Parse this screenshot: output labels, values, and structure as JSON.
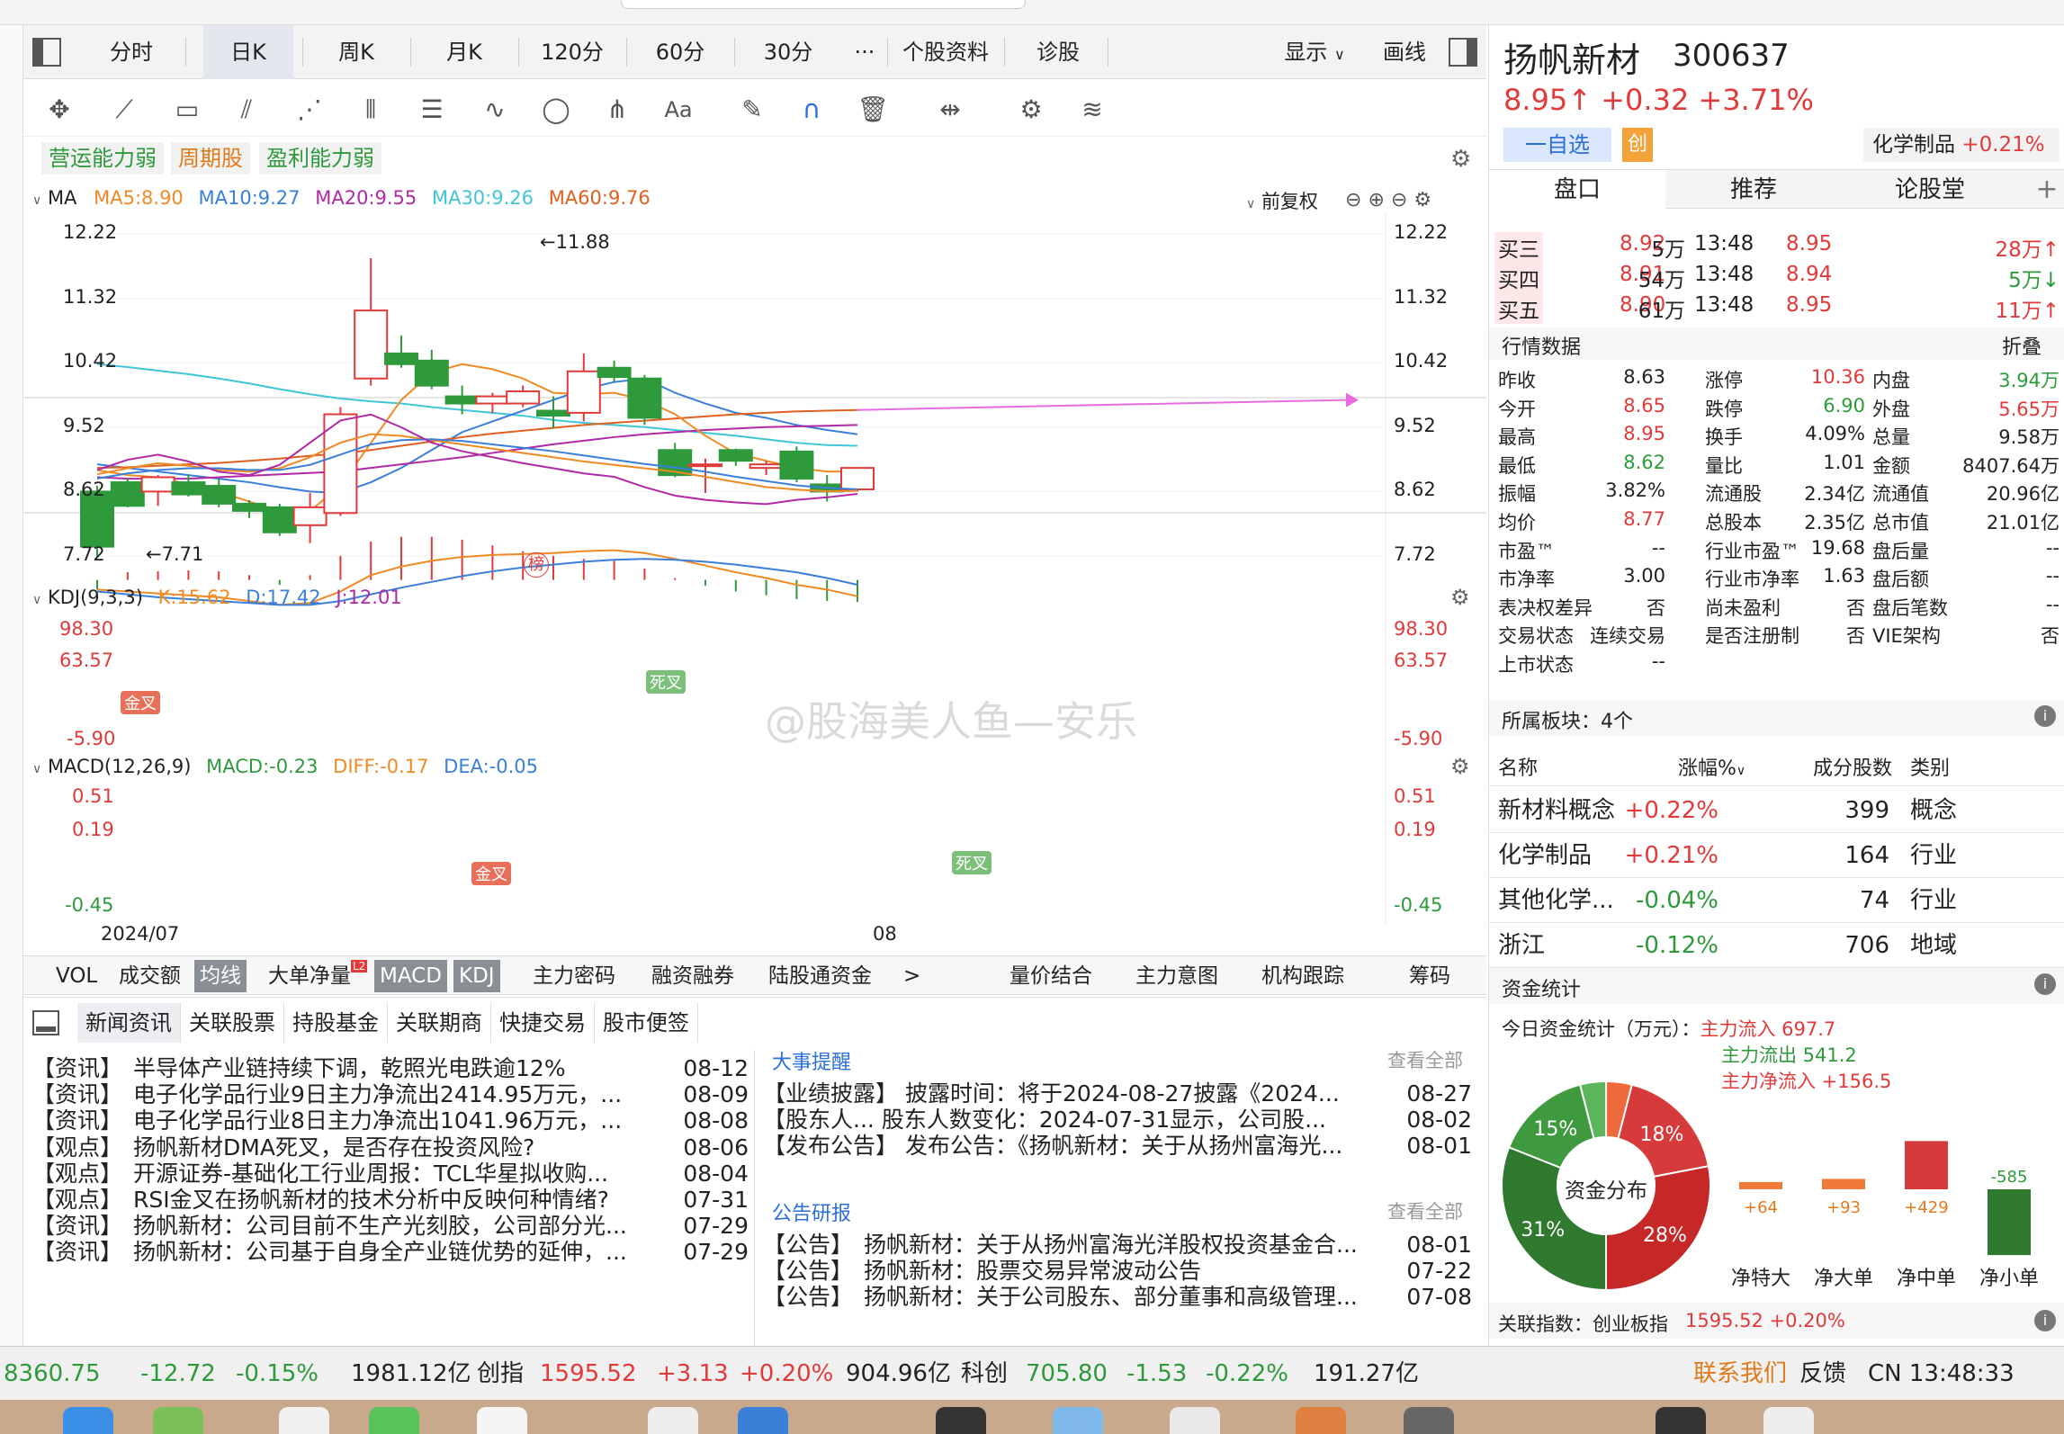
{
  "kline_tabs": [
    "分时",
    "日K",
    "周K",
    "月K",
    "120分",
    "60分",
    "30分",
    "···",
    "个股资料",
    "诊股"
  ],
  "right_tabs": {
    "display": "显示",
    "draw": "画线"
  },
  "tags": [
    "营运能力弱",
    "周期股",
    "盈利能力弱"
  ],
  "ma": {
    "label": "MA",
    "ma5": "MA5:8.90",
    "ma10": "MA10:9.27",
    "ma20": "MA20:9.55",
    "ma30": "MA30:9.26",
    "ma60": "MA60:9.76",
    "adjust": "前复权"
  },
  "price_axis": [
    "12.22",
    "11.32",
    "10.42",
    "9.52",
    "8.62",
    "7.72"
  ],
  "annotations": {
    "high": "←11.88",
    "low": "←7.71",
    "bang": "榜"
  },
  "kdj": {
    "label": "KDJ(9,3,3)",
    "k": "K:15.62",
    "d": "D:17.42",
    "j": "J:12.01",
    "axis": [
      "98.30",
      "63.57",
      "-5.90"
    ],
    "golden": "金叉",
    "dead": "死叉"
  },
  "macd": {
    "label": "MACD(12,26,9)",
    "macd": "MACD:-0.23",
    "diff": "DIFF:-0.17",
    "dea": "DEA:-0.05",
    "axis": [
      "0.51",
      "0.19",
      "-0.45"
    ],
    "golden": "金叉",
    "dead": "死叉",
    "date_left": "2024/07",
    "date_mid": "08"
  },
  "watermark": "@股海美人鱼—安乐",
  "indicator_tabs": [
    "VOL",
    "成交额",
    "均线",
    "大单净量",
    "MACD",
    "KDJ",
    "主力密码",
    "融资融券",
    "陆股通资金",
    ">"
  ],
  "indicator_tabs_right": [
    "量价结合",
    "主力意图",
    "机构跟踪",
    "筹码"
  ],
  "l2_badge": "L2",
  "stock": {
    "name": "扬帆新材",
    "code": "300637",
    "price": "8.95↑",
    "change": "+0.32",
    "pct": "+3.71%",
    "watch": "一自选",
    "chuang": "创",
    "industry": "化学制品",
    "industry_pct": "+0.21%"
  },
  "rp_tabs": [
    "盘口",
    "推荐",
    "论股堂",
    "+"
  ],
  "orderbook": [
    {
      "label": "买三",
      "price": "8.92",
      "vol": "5万",
      "time": "13:48",
      "tprice": "8.95",
      "tvol": "28万↑"
    },
    {
      "label": "买四",
      "price": "8.91",
      "vol": "54万",
      "time": "13:48",
      "tprice": "8.94",
      "tvol": "5万↓"
    },
    {
      "label": "买五",
      "price": "8.90",
      "vol": "61万",
      "time": "13:48",
      "tprice": "8.95",
      "tvol": "11万↑"
    }
  ],
  "quote_header": {
    "title": "行情数据",
    "fold": "折叠"
  },
  "quote": [
    [
      "昨收",
      "8.63",
      "涨停",
      "10.36",
      "内盘",
      "3.94万"
    ],
    [
      "今开",
      "8.65",
      "跌停",
      "6.90",
      "外盘",
      "5.65万"
    ],
    [
      "最高",
      "8.95",
      "换手",
      "4.09%",
      "总量",
      "9.58万"
    ],
    [
      "最低",
      "8.62",
      "量比",
      "1.01",
      "金额",
      "8407.64万"
    ],
    [
      "振幅",
      "3.82%",
      "流通股",
      "2.34亿",
      "流通值",
      "20.96亿"
    ],
    [
      "均价",
      "8.77",
      "总股本",
      "2.35亿",
      "总市值",
      "21.01亿"
    ],
    [
      "市盈™",
      "--",
      "行业市盈™",
      "19.68",
      "盘后量",
      "--"
    ],
    [
      "市净率",
      "3.00",
      "行业市净率",
      "1.63",
      "盘后额",
      "--"
    ],
    [
      "表决权差异",
      "否",
      "尚未盈利",
      "否",
      "盘后笔数",
      "--"
    ],
    [
      "交易状态",
      "连续交易",
      "是否注册制",
      "否",
      "VIE架构",
      "否"
    ],
    [
      "上市状态",
      "--",
      "",
      "",
      "",
      ""
    ]
  ],
  "plates": {
    "title": "所属板块：4个",
    "headers": [
      "名称",
      "涨幅%",
      "成分股数",
      "类别"
    ],
    "rows": [
      {
        "name": "新材料概念",
        "pct": "+0.22%",
        "count": "399",
        "type": "概念"
      },
      {
        "name": "化学制品",
        "pct": "+0.21%",
        "count": "164",
        "type": "行业"
      },
      {
        "name": "其他化学...",
        "pct": "-0.04%",
        "count": "74",
        "type": "行业"
      },
      {
        "name": "浙江",
        "pct": "-0.12%",
        "count": "706",
        "type": "地域"
      }
    ]
  },
  "fund": {
    "title": "资金统计",
    "today": "今日资金统计（万元）：",
    "inflow": "主力流入 697.7",
    "outflow": "主力流出 541.2",
    "net": "主力净流入 +156.5",
    "center": "资金分布",
    "pie": [
      {
        "label": "18%",
        "value": 18,
        "color": "#d73a3a"
      },
      {
        "label": "28%",
        "value": 28,
        "color": "#c62828"
      },
      {
        "label": "31%",
        "value": 31,
        "color": "#2f7a2f"
      },
      {
        "label": "15%",
        "value": 15,
        "color": "#3f9a3f"
      },
      {
        "label": "",
        "value": 4,
        "color": "#5bb55b"
      },
      {
        "label": "",
        "value": 4,
        "color": "#ef6a3a"
      }
    ],
    "bars": [
      {
        "name": "净特大",
        "value": 64,
        "label": "+64"
      },
      {
        "name": "净大单",
        "value": 93,
        "label": "+93"
      },
      {
        "name": "净中单",
        "value": 429,
        "label": "+429"
      },
      {
        "name": "净小单",
        "value": -585,
        "label": "-585"
      }
    ],
    "related": "关联指数：创业板指",
    "related_val": "1595.52 +0.20%"
  },
  "news_tabs": [
    "新闻资讯",
    "关联股票",
    "持股基金",
    "关联期商",
    "快捷交易",
    "股市便签"
  ],
  "news": [
    {
      "tag": "【资讯】",
      "text": "半导体产业链持续下调，乾照光电跌逾12%",
      "date": "08-12"
    },
    {
      "tag": "【资讯】",
      "text": "电子化学品行业9日主力净流出2414.95万元，...",
      "date": "08-09"
    },
    {
      "tag": "【资讯】",
      "text": "电子化学品行业8日主力净流出1041.96万元，...",
      "date": "08-08"
    },
    {
      "tag": "【观点】",
      "text": "扬帆新材DMA死叉，是否存在投资风险?",
      "date": "08-06"
    },
    {
      "tag": "【观点】",
      "text": "开源证券-基础化工行业周报：TCL华星拟收购...",
      "date": "08-04"
    },
    {
      "tag": "【观点】",
      "text": "RSI金叉在扬帆新材的技术分析中反映何种情绪?",
      "date": "07-31"
    },
    {
      "tag": "【资讯】",
      "text": "扬帆新材：公司目前不生产光刻胶，公司部分光...",
      "date": "07-29"
    },
    {
      "tag": "【资讯】",
      "text": "扬帆新材：公司基于自身全产业链优势的延伸，...",
      "date": "07-29"
    }
  ],
  "events_title": "大事提醒",
  "view_all": "查看全部",
  "events": [
    {
      "tag": "【业绩披露】",
      "text": "披露时间：将于2024-08-27披露《2024...",
      "date": "08-27"
    },
    {
      "tag": "【股东人...",
      "text": "股东人数变化：2024-07-31显示，公司股...",
      "date": "08-02"
    },
    {
      "tag": "【发布公告】",
      "text": "发布公告：《扬帆新材：关于从扬州富海光...",
      "date": "08-01"
    }
  ],
  "research_title": "公告研报",
  "research": [
    {
      "tag": "【公告】",
      "text": "扬帆新材：关于从扬州富海光洋股权投资基金合...",
      "date": "08-01"
    },
    {
      "tag": "【公告】",
      "text": "扬帆新材：股票交易异常波动公告",
      "date": "07-22"
    },
    {
      "tag": "【公告】",
      "text": "扬帆新材：关于公司股东、部分董事和高级管理...",
      "date": "07-08"
    }
  ],
  "status": {
    "sh": "8360.75",
    "sh_chg": "-12.72",
    "sh_pct": "-0.15%",
    "sh_amt": "1981.12亿",
    "cy_name": "创指",
    "cy": "1595.52",
    "cy_chg": "+3.13",
    "cy_pct": "+0.20%",
    "cy_amt": "904.96亿",
    "kc_name": "科创",
    "kc": "705.80",
    "kc_chg": "-1.53",
    "kc_pct": "-0.22%",
    "kc_amt": "191.27亿",
    "contact": "联系我们",
    "feedback": "反馈",
    "clock": "CN 13:48:33"
  },
  "colors": {
    "up": "#e03a3a",
    "down": "#2e9a3c",
    "ma5": "#f08a24",
    "ma10": "#3a7fd8",
    "ma20": "#b02aa5",
    "ma30": "#41c6d8",
    "ma60": "#e06020"
  },
  "chart_data": {
    "type": "candlestick",
    "ylim": [
      7.72,
      12.22
    ],
    "candles": [
      {
        "o": 8.62,
        "c": 7.85,
        "h": 8.7,
        "l": 7.71,
        "up": false
      },
      {
        "o": 8.75,
        "c": 8.42,
        "h": 8.8,
        "l": 8.4,
        "up": false
      },
      {
        "o": 8.62,
        "c": 8.82,
        "h": 8.85,
        "l": 8.42,
        "up": true
      },
      {
        "o": 8.75,
        "c": 8.58,
        "h": 8.85,
        "l": 8.55,
        "up": false
      },
      {
        "o": 8.7,
        "c": 8.45,
        "h": 8.8,
        "l": 8.4,
        "up": false
      },
      {
        "o": 8.45,
        "c": 8.35,
        "h": 8.5,
        "l": 8.25,
        "up": false
      },
      {
        "o": 8.4,
        "c": 8.05,
        "h": 8.45,
        "l": 8.0,
        "up": false
      },
      {
        "o": 8.15,
        "c": 8.4,
        "h": 8.6,
        "l": 7.9,
        "up": true
      },
      {
        "o": 8.32,
        "c": 9.7,
        "h": 9.8,
        "l": 8.28,
        "up": true
      },
      {
        "o": 10.2,
        "c": 11.15,
        "h": 11.88,
        "l": 10.1,
        "up": true
      },
      {
        "o": 10.55,
        "c": 10.4,
        "h": 10.8,
        "l": 10.35,
        "up": false
      },
      {
        "o": 10.45,
        "c": 10.1,
        "h": 10.6,
        "l": 10.05,
        "up": false
      },
      {
        "o": 9.95,
        "c": 9.85,
        "h": 10.1,
        "l": 9.7,
        "up": false
      },
      {
        "o": 9.85,
        "c": 9.95,
        "h": 10.0,
        "l": 9.72,
        "up": true
      },
      {
        "o": 9.85,
        "c": 10.02,
        "h": 10.1,
        "l": 9.8,
        "up": true
      },
      {
        "o": 9.75,
        "c": 9.68,
        "h": 9.95,
        "l": 9.5,
        "up": false
      },
      {
        "o": 9.72,
        "c": 10.3,
        "h": 10.55,
        "l": 9.6,
        "up": true
      },
      {
        "o": 10.35,
        "c": 10.22,
        "h": 10.45,
        "l": 10.15,
        "up": false
      },
      {
        "o": 10.2,
        "c": 9.65,
        "h": 10.25,
        "l": 9.55,
        "up": false
      },
      {
        "o": 9.2,
        "c": 8.85,
        "h": 9.3,
        "l": 8.82,
        "up": false
      },
      {
        "o": 9.0,
        "c": 9.0,
        "h": 9.08,
        "l": 8.6,
        "up": true
      },
      {
        "o": 9.2,
        "c": 9.05,
        "h": 9.22,
        "l": 8.98,
        "up": false
      },
      {
        "o": 9.0,
        "c": 8.95,
        "h": 9.05,
        "l": 8.85,
        "up": true
      },
      {
        "o": 9.18,
        "c": 8.8,
        "h": 9.25,
        "l": 8.75,
        "up": false
      },
      {
        "o": 8.72,
        "c": 8.62,
        "h": 8.85,
        "l": 8.48,
        "up": false
      },
      {
        "o": 8.65,
        "c": 8.95,
        "h": 8.95,
        "l": 8.62,
        "up": true
      }
    ],
    "ma5": [
      8.92,
      8.85,
      8.82,
      8.72,
      8.62,
      8.48,
      8.35,
      8.35,
      8.7,
      9.3,
      9.9,
      10.28,
      10.4,
      10.33,
      10.2,
      10.0,
      9.98,
      10.0,
      9.9,
      9.7,
      9.4,
      9.15,
      9.05,
      8.95,
      8.9,
      8.9
    ],
    "ma10": [
      9.0,
      8.95,
      8.9,
      8.85,
      8.8,
      8.75,
      8.68,
      8.62,
      8.6,
      8.75,
      8.95,
      9.2,
      9.45,
      9.6,
      9.75,
      9.9,
      10.05,
      10.15,
      10.2,
      10.0,
      9.85,
      9.72,
      9.65,
      9.55,
      9.48,
      9.42
    ],
    "ma20": [
      8.82,
      8.8,
      8.8,
      8.8,
      8.82,
      8.84,
      8.86,
      8.88,
      8.9,
      8.95,
      9.0,
      9.05,
      9.1,
      9.16,
      9.22,
      9.28,
      9.33,
      9.38,
      9.42,
      9.45,
      9.48,
      9.5,
      9.52,
      9.53,
      9.54,
      9.55
    ],
    "ma30": [
      10.4,
      10.36,
      10.31,
      10.26,
      10.2,
      10.13,
      10.05,
      9.98,
      9.92,
      9.88,
      9.85,
      9.8,
      9.76,
      9.72,
      9.68,
      9.62,
      9.58,
      9.55,
      9.52,
      9.48,
      9.44,
      9.4,
      9.35,
      9.3,
      9.27,
      9.26
    ],
    "ma60": [
      8.95,
      8.96,
      8.98,
      9.0,
      9.02,
      9.05,
      9.08,
      9.12,
      9.15,
      9.2,
      9.26,
      9.32,
      9.38,
      9.43,
      9.47,
      9.51,
      9.55,
      9.58,
      9.61,
      9.64,
      9.67,
      9.7,
      9.72,
      9.74,
      9.75,
      9.76
    ],
    "kdj_k": [
      35,
      42,
      48,
      45,
      40,
      38,
      42,
      55,
      72,
      82,
      80,
      75,
      70,
      65,
      60,
      55,
      50,
      46,
      42,
      38,
      32,
      26,
      20,
      17,
      15,
      15.62
    ],
    "kdj_d": [
      30,
      36,
      40,
      42,
      42,
      40,
      40,
      46,
      58,
      70,
      75,
      76,
      74,
      70,
      66,
      62,
      57,
      52,
      47,
      43,
      38,
      32,
      27,
      22,
      19,
      17.42
    ],
    "kdj_j": [
      40,
      52,
      58,
      50,
      38,
      34,
      46,
      72,
      98,
      105,
      90,
      72,
      62,
      55,
      48,
      42,
      36,
      32,
      20,
      10,
      5,
      2,
      0,
      5,
      8,
      12.01
    ],
    "macd_diff": [
      -0.1,
      -0.12,
      -0.14,
      -0.16,
      -0.18,
      -0.22,
      -0.26,
      -0.24,
      -0.12,
      0.05,
      0.14,
      0.2,
      0.24,
      0.26,
      0.27,
      0.28,
      0.3,
      0.31,
      0.28,
      0.22,
      0.15,
      0.08,
      0.02,
      -0.05,
      -0.1,
      -0.17
    ],
    "macd_dea": [
      -0.12,
      -0.15,
      -0.18,
      -0.2,
      -0.22,
      -0.24,
      -0.26,
      -0.26,
      -0.22,
      -0.15,
      -0.08,
      -0.02,
      0.04,
      0.09,
      0.13,
      0.16,
      0.19,
      0.21,
      0.22,
      0.21,
      0.19,
      0.16,
      0.12,
      0.08,
      0.02,
      -0.05
    ],
    "macd_hist": [
      -0.1,
      0.08,
      0.09,
      0.1,
      0.09,
      0.05,
      -0.05,
      0.05,
      0.25,
      0.4,
      0.45,
      0.45,
      0.42,
      0.36,
      0.3,
      0.25,
      0.22,
      0.2,
      0.12,
      0.02,
      -0.06,
      -0.12,
      -0.16,
      -0.2,
      -0.22,
      -0.23
    ]
  }
}
